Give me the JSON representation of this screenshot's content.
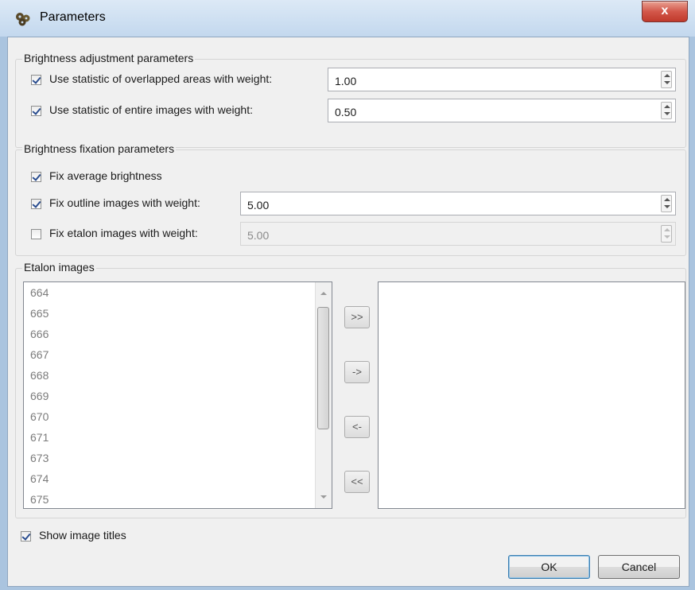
{
  "window": {
    "title": "Parameters",
    "close_label": "x",
    "app_icon": "gear-cluster-icon"
  },
  "brightness_adjustment": {
    "title": "Brightness adjustment parameters",
    "overlapped": {
      "label": "Use statistic of overlapped areas with weight:",
      "checked": true,
      "value": "1.00"
    },
    "entire": {
      "label": "Use statistic of entire images with weight:",
      "checked": true,
      "value": "0.50"
    }
  },
  "brightness_fixation": {
    "title": "Brightness fixation parameters",
    "average": {
      "label": "Fix average brightness",
      "checked": true
    },
    "outline": {
      "label": "Fix outline images with weight:",
      "checked": true,
      "value": "5.00"
    },
    "etalon": {
      "label": "Fix etalon images with weight:",
      "checked": false,
      "value": "5.00",
      "enabled": false
    }
  },
  "etalon_images": {
    "title": "Etalon images",
    "available": [
      "664",
      "665",
      "666",
      "667",
      "668",
      "669",
      "670",
      "671",
      "673",
      "674",
      "675"
    ],
    "selected": [],
    "buttons": {
      "add_all": ">>",
      "add": "->",
      "remove": "<-",
      "remove_all": "<<"
    }
  },
  "show_titles": {
    "label": "Show image titles",
    "checked": true
  },
  "footer": {
    "ok": "OK",
    "cancel": "Cancel"
  },
  "colors": {
    "title_bar": "#c9dcf0",
    "close_button": "#d3574a",
    "dialog_bg": "#f0f0f0"
  }
}
